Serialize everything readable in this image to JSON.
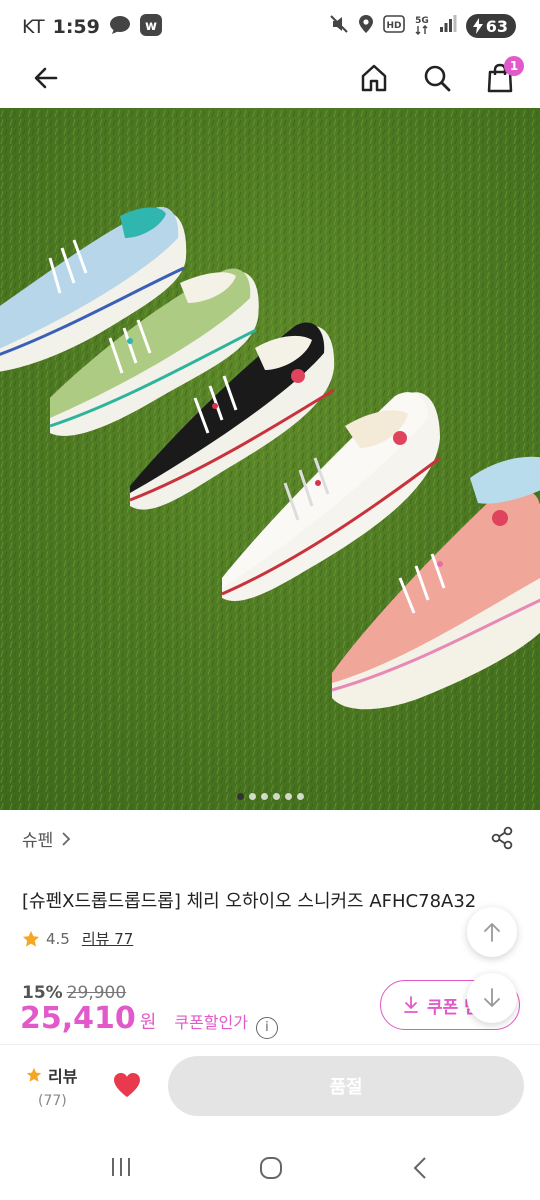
{
  "status_bar": {
    "carrier": "KT",
    "time": "1:59",
    "battery": "63",
    "icons": [
      "talk-icon",
      "w-app-icon",
      "mute-icon",
      "location-icon",
      "hd-icon",
      "5g-icon",
      "signal-icon",
      "battery-icon"
    ]
  },
  "header": {
    "icons": [
      "back-arrow-icon",
      "home-icon",
      "search-icon",
      "cart-icon"
    ],
    "cart_count": "1",
    "accent": "#e259c9"
  },
  "carousel": {
    "total": 6,
    "active_index": 0
  },
  "product": {
    "brand": "슈펜",
    "title": "[슈펜X드롭드롭드롭] 체리 오하이오 스니커즈 AFHC78A32",
    "rating": "4.5",
    "review_label": "리뷰 77",
    "discount": "15%",
    "original_price": "29,900",
    "sale_price": "25,410",
    "currency": "원",
    "coupon_discount_label": "쿠폰할인가"
  },
  "coupon_button": {
    "label": "쿠폰 받"
  },
  "bottom_bar": {
    "review_label": "리뷰",
    "review_count": "(77)",
    "sold_out_label": "품절",
    "heart_color": "#e8394d"
  },
  "colors": {
    "primary": "#e259c9",
    "star": "#f5a623",
    "disabled": "#e4e4e4"
  }
}
